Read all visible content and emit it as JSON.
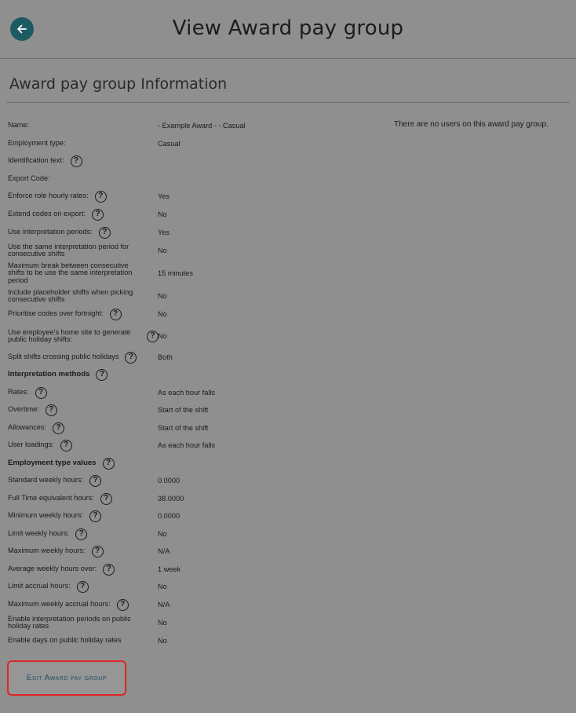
{
  "header": {
    "title": "View Award pay group",
    "back_icon": "arrow-left-icon"
  },
  "section": {
    "title": "Award pay group Information",
    "users_note": "There are no users on this award pay group."
  },
  "rows": [
    {
      "label": "Name:",
      "value": "- Example Award - - Casual",
      "help": false
    },
    {
      "label": "Employment type:",
      "value": "Casual",
      "help": false
    },
    {
      "label": "Identification text:",
      "value": "",
      "help": true
    },
    {
      "label": "Export Code:",
      "value": "",
      "help": false
    },
    {
      "label": "Enforce role hourly rates:",
      "value": "Yes",
      "help": true
    },
    {
      "label": "Extend codes on export:",
      "value": "No",
      "help": true
    },
    {
      "label": "Use interpretation periods:",
      "value": "Yes",
      "help": true
    },
    {
      "label": "Use the same interpretation period for consecutive shifts",
      "value": "No",
      "help": false
    },
    {
      "label": "Maximum break between consecutive shifts to be use the same interpretation period",
      "value": "15 minutes",
      "help": false
    },
    {
      "label": "Include placeholder shifts when picking consecutive shifts",
      "value": "No",
      "help": false
    },
    {
      "label": "Prioritise codes over fortnight:",
      "value": "No",
      "help": true
    },
    {
      "label": "Use employee's home site to generate public holiday shifts:",
      "value": "No",
      "help": true
    },
    {
      "label": "Split shifts crossing public holidays",
      "value": "Both",
      "help": true
    },
    {
      "label": "Interpretation methods",
      "value": "",
      "help": true,
      "bold": true
    },
    {
      "label": "Rates:",
      "value": "As each hour falls",
      "help": true
    },
    {
      "label": "Overtime:",
      "value": "Start of the shift",
      "help": true
    },
    {
      "label": "Allowances:",
      "value": "Start of the shift",
      "help": true
    },
    {
      "label": "User loadings:",
      "value": "As each hour falls",
      "help": true
    },
    {
      "label": "Employment type values",
      "value": "",
      "help": true,
      "bold": true
    },
    {
      "label": "Standard weekly hours:",
      "value": "0.0000",
      "help": true
    },
    {
      "label": "Full Time equivalent hours:",
      "value": "38.0000",
      "help": true
    },
    {
      "label": "Minimum weekly hours:",
      "value": "0.0000",
      "help": true
    },
    {
      "label": "Limit weekly hours:",
      "value": "No",
      "help": true
    },
    {
      "label": "Maximum weekly hours:",
      "value": "N/A",
      "help": true
    },
    {
      "label": "Average weekly hours over:",
      "value": "1 week",
      "help": true
    },
    {
      "label": "Limit accrual hours:",
      "value": "No",
      "help": true
    },
    {
      "label": "Maximum weekly accrual hours:",
      "value": "N/A",
      "help": true
    },
    {
      "label": "Enable interpretation periods on public holiday rates",
      "value": "No",
      "help": false
    },
    {
      "label": "Enable days on public holiday rates",
      "value": "No",
      "help": false
    }
  ],
  "help_glyph": "?",
  "help_icon": "question-circle-icon",
  "edit_button": {
    "label": "Edit Award pay group"
  },
  "colors": {
    "background": "#8f8f8f",
    "back_button": "#1e5a62",
    "edit_border": "#e02424",
    "edit_text": "#1e4f63"
  }
}
